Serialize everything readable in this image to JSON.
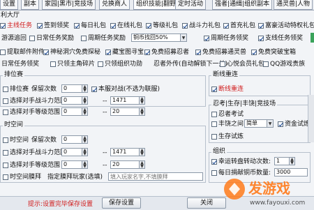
{
  "tabs": [
    "设置",
    "副本",
    "家园|黑市|竞技场",
    "兑换商人",
    "组织技能|翻野",
    "定时活动",
    "强者|通缉|组织副本",
    "通灵兽|人物"
  ],
  "section_title": "利大厅",
  "row1": [
    "主线任务",
    "签到领奖",
    "每日礼包",
    "在线礼包",
    "等级礼包",
    "战斗力礼包",
    "首充礼包",
    "富豪活动特权礼包",
    "礼包"
  ],
  "row2": {
    "c1": "游源追回",
    "c2": "日常任务奖励",
    "c3": "周期任务奖励",
    "select_value": "铜币找回50%",
    "c4": "周期任务领奖",
    "c5": "支线任务领奖"
  },
  "row3": [
    "提取邮件附件",
    "神秘洞穴免费探秘",
    "藏宝图寻宝",
    "免费招募忍者",
    "免费招募通灵兽",
    "免费突破宝箱"
  ],
  "row4": [
    "日常任务领奖",
    "只领主角碎片",
    "只领组织功勋",
    "忍者外传(自动解锁下一关)",
    "心悦会员礼包",
    "QQ游戏贵族"
  ],
  "left_top": {
    "group_title": "排位赛",
    "row_a": {
      "label": "排位赛",
      "keep": "保留次数",
      "count": "0",
      "auto": "本服对战(不选为联服)"
    },
    "row_b": {
      "label": "选择对手战斗力范围",
      "min": "0",
      "max": "1471"
    },
    "row_c": {
      "label": "选择对手等级范围",
      "min": "0",
      "max": "20"
    }
  },
  "left_bottom": {
    "group_title": "时空间",
    "row_a": {
      "label": "时空间",
      "keep": "保留次数",
      "count": "0"
    },
    "row_b": {
      "label": "选择对手战斗力范围",
      "min": "0",
      "max": "1471"
    },
    "row_c": {
      "label": "选择对手等级范围",
      "min": "0",
      "max": "20"
    },
    "row_d": {
      "label": "时空间膜拜",
      "text": "指定膜拜玩家(选填)",
      "placeholder": "填入玩家名字,不填膜拜"
    }
  },
  "right_top": {
    "title": "断线重连",
    "item": "断线重连"
  },
  "right_mid": {
    "title": "忍考|生存|丰饶|竞技场",
    "a": "忍者考试",
    "b": "丰饶之间",
    "c_value": "简单",
    "d": "资金试炼",
    "e": "生存试炼"
  },
  "right_bottom": {
    "title": "组织",
    "a": "幸运转盘转动次数:",
    "a_val": "1",
    "b": "每日捐献铜币数量:",
    "b_val": "3000"
  },
  "buttons": {
    "save": "保存设置",
    "close": "关闭"
  },
  "status": {
    "hint": "提示:设置完毕保存设置"
  },
  "watermark": {
    "brand": "发游戏",
    "url": "www.fayouxi.com"
  }
}
